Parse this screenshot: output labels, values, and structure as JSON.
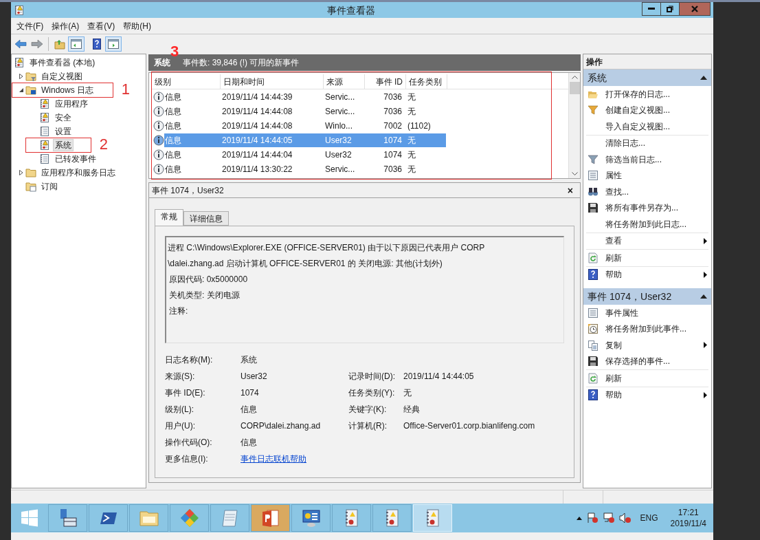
{
  "window": {
    "title": "事件查看器"
  },
  "menu": [
    {
      "label": "文件(F)"
    },
    {
      "label": "操作(A)"
    },
    {
      "label": "查看(V)"
    },
    {
      "label": "帮助(H)"
    }
  ],
  "toolbar": [
    {
      "kind": "back",
      "pressed": false
    },
    {
      "kind": "forward",
      "pressed": false
    },
    {
      "kind": "up-folder",
      "pressed": false
    },
    {
      "kind": "tree-pane",
      "pressed": true
    },
    {
      "kind": "help",
      "pressed": false
    },
    {
      "kind": "action-pane",
      "pressed": true
    }
  ],
  "tree": {
    "label": "事件查看器 (本地)",
    "kind": "root",
    "selected": false,
    "children": [
      {
        "label": "自定义视图",
        "kind": "filter-folder",
        "expanded": false,
        "selected": false
      },
      {
        "label": "Windows 日志",
        "kind": "windows-folder",
        "expanded": true,
        "selected": false,
        "annotation": "1",
        "children": [
          {
            "label": "应用程序",
            "kind": "log",
            "selected": false
          },
          {
            "label": "安全",
            "kind": "log",
            "selected": false
          },
          {
            "label": "设置",
            "kind": "plain-log",
            "selected": false
          },
          {
            "label": "系统",
            "kind": "log",
            "selected": true,
            "annotation": "2"
          },
          {
            "label": "已转发事件",
            "kind": "plain-log",
            "selected": false
          }
        ]
      },
      {
        "label": "应用程序和服务日志",
        "kind": "folder",
        "expanded": false,
        "selected": false
      },
      {
        "label": "订阅",
        "kind": "subscription",
        "selected": false
      }
    ]
  },
  "log_header": {
    "title": "系统",
    "summary": "事件数: 39,846 (!) 可用的新事件"
  },
  "events": {
    "annotation": "3",
    "columns": [
      "级别",
      "日期和时间",
      "来源",
      "事件 ID",
      "任务类别"
    ],
    "rows": [
      {
        "cells": [
          "信息",
          "2019/11/4 14:44:39",
          "Servic...",
          "7036",
          "无"
        ],
        "selected": false
      },
      {
        "cells": [
          "信息",
          "2019/11/4 14:44:08",
          "Servic...",
          "7036",
          "无"
        ],
        "selected": false
      },
      {
        "cells": [
          "信息",
          "2019/11/4 14:44:08",
          "Winlo...",
          "7002",
          "(1102)"
        ],
        "selected": false
      },
      {
        "cells": [
          "信息",
          "2019/11/4 14:44:05",
          "User32",
          "1074",
          "无"
        ],
        "selected": true
      },
      {
        "cells": [
          "信息",
          "2019/11/4 14:44:04",
          "User32",
          "1074",
          "无"
        ],
        "selected": false
      },
      {
        "cells": [
          "信息",
          "2019/11/4 13:30:22",
          "Servic...",
          "7036",
          "无"
        ],
        "selected": false
      }
    ]
  },
  "detail": {
    "title": "事件 1074，User32",
    "close": "×",
    "tabs": [
      {
        "label": "常规",
        "selected": true
      },
      {
        "label": "详细信息",
        "selected": false
      }
    ],
    "message": [
      "进程 C:\\Windows\\Explorer.EXE (OFFICE-SERVER01) 由于以下原因已代表用户 CORP",
      "\\dalei.zhang.ad 启动计算机 OFFICE-SERVER01 的 关闭电源: 其他(计划外)",
      "原因代码: 0x5000000",
      "关机类型: 关闭电源",
      "注释:"
    ],
    "fields": [
      {
        "label": "日志名称(M):",
        "value": "系统"
      },
      {
        "label": "来源(S):",
        "value": "User32",
        "right_label": "记录时间(D):",
        "right_value": "2019/11/4 14:44:05"
      },
      {
        "label": "事件 ID(E):",
        "value": "1074",
        "right_label": "任务类别(Y):",
        "right_value": "无"
      },
      {
        "label": "级别(L):",
        "value": "信息",
        "right_label": "关键字(K):",
        "right_value": "经典"
      },
      {
        "label": "用户(U):",
        "value": "CORP\\dalei.zhang.ad",
        "right_label": "计算机(R):",
        "right_value": "Office-Server01.corp.bianlifeng.com"
      },
      {
        "label": "操作代码(O):",
        "value": "信息"
      },
      {
        "label": "更多信息(I):",
        "value": "事件日志联机帮助",
        "kind": "link"
      }
    ]
  },
  "actions": {
    "title": "操作",
    "sections": [
      {
        "title": "系统",
        "expanded": true,
        "items": [
          {
            "label": "打开保存的日志...",
            "kind": "open-folder",
            "submenu": false,
            "divider_before": false
          },
          {
            "label": "创建自定义视图...",
            "kind": "filter-gold",
            "submenu": false,
            "divider_before": false
          },
          {
            "label": "导入自定义视图...",
            "kind": "none",
            "submenu": false,
            "divider_before": false
          },
          {
            "label": "清除日志...",
            "kind": "none",
            "submenu": false,
            "divider_before": true
          },
          {
            "label": "筛选当前日志...",
            "kind": "filter",
            "submenu": false,
            "divider_before": false
          },
          {
            "label": "属性",
            "kind": "properties",
            "submenu": false,
            "divider_before": false
          },
          {
            "label": "查找...",
            "kind": "find",
            "submenu": false,
            "divider_before": false
          },
          {
            "label": "将所有事件另存为...",
            "kind": "save",
            "submenu": false,
            "divider_before": false
          },
          {
            "label": "将任务附加到此日志...",
            "kind": "none",
            "submenu": false,
            "divider_before": false
          },
          {
            "label": "查看",
            "kind": "none",
            "submenu": true,
            "divider_before": true
          },
          {
            "label": "刷新",
            "kind": "refresh",
            "submenu": false,
            "divider_before": true
          },
          {
            "label": "帮助",
            "kind": "help",
            "submenu": true,
            "divider_before": true
          }
        ]
      },
      {
        "title": "事件 1074，User32",
        "expanded": true,
        "items": [
          {
            "label": "事件属性",
            "kind": "properties",
            "submenu": false,
            "divider_before": false
          },
          {
            "label": "将任务附加到此事件...",
            "kind": "task",
            "submenu": false,
            "divider_before": false
          },
          {
            "label": "复制",
            "kind": "copy",
            "submenu": true,
            "divider_before": false
          },
          {
            "label": "保存选择的事件...",
            "kind": "save",
            "submenu": false,
            "divider_before": false
          },
          {
            "label": "刷新",
            "kind": "refresh",
            "submenu": false,
            "divider_before": true
          },
          {
            "label": "帮助",
            "kind": "help",
            "submenu": true,
            "divider_before": true
          }
        ]
      }
    ]
  },
  "taskbar": {
    "buttons": [
      {
        "kind": "start",
        "active": false,
        "hovered": false
      },
      {
        "kind": "server-manager",
        "active": false,
        "hovered": false
      },
      {
        "kind": "powershell",
        "active": false,
        "hovered": false
      },
      {
        "kind": "explorer",
        "active": false,
        "hovered": false
      },
      {
        "kind": "diamond-app",
        "active": false,
        "hovered": false
      },
      {
        "kind": "notepad",
        "active": false,
        "hovered": false
      },
      {
        "kind": "powerpoint",
        "active": true,
        "hovered": false
      },
      {
        "kind": "control-panel",
        "active": false,
        "hovered": false
      },
      {
        "kind": "event-viewer",
        "active": false,
        "hovered": false
      },
      {
        "kind": "event-viewer",
        "active": false,
        "hovered": false
      },
      {
        "kind": "event-viewer",
        "active": false,
        "hovered": true
      }
    ],
    "language": "ENG",
    "time": "17:21",
    "date": "2019/11/4"
  }
}
